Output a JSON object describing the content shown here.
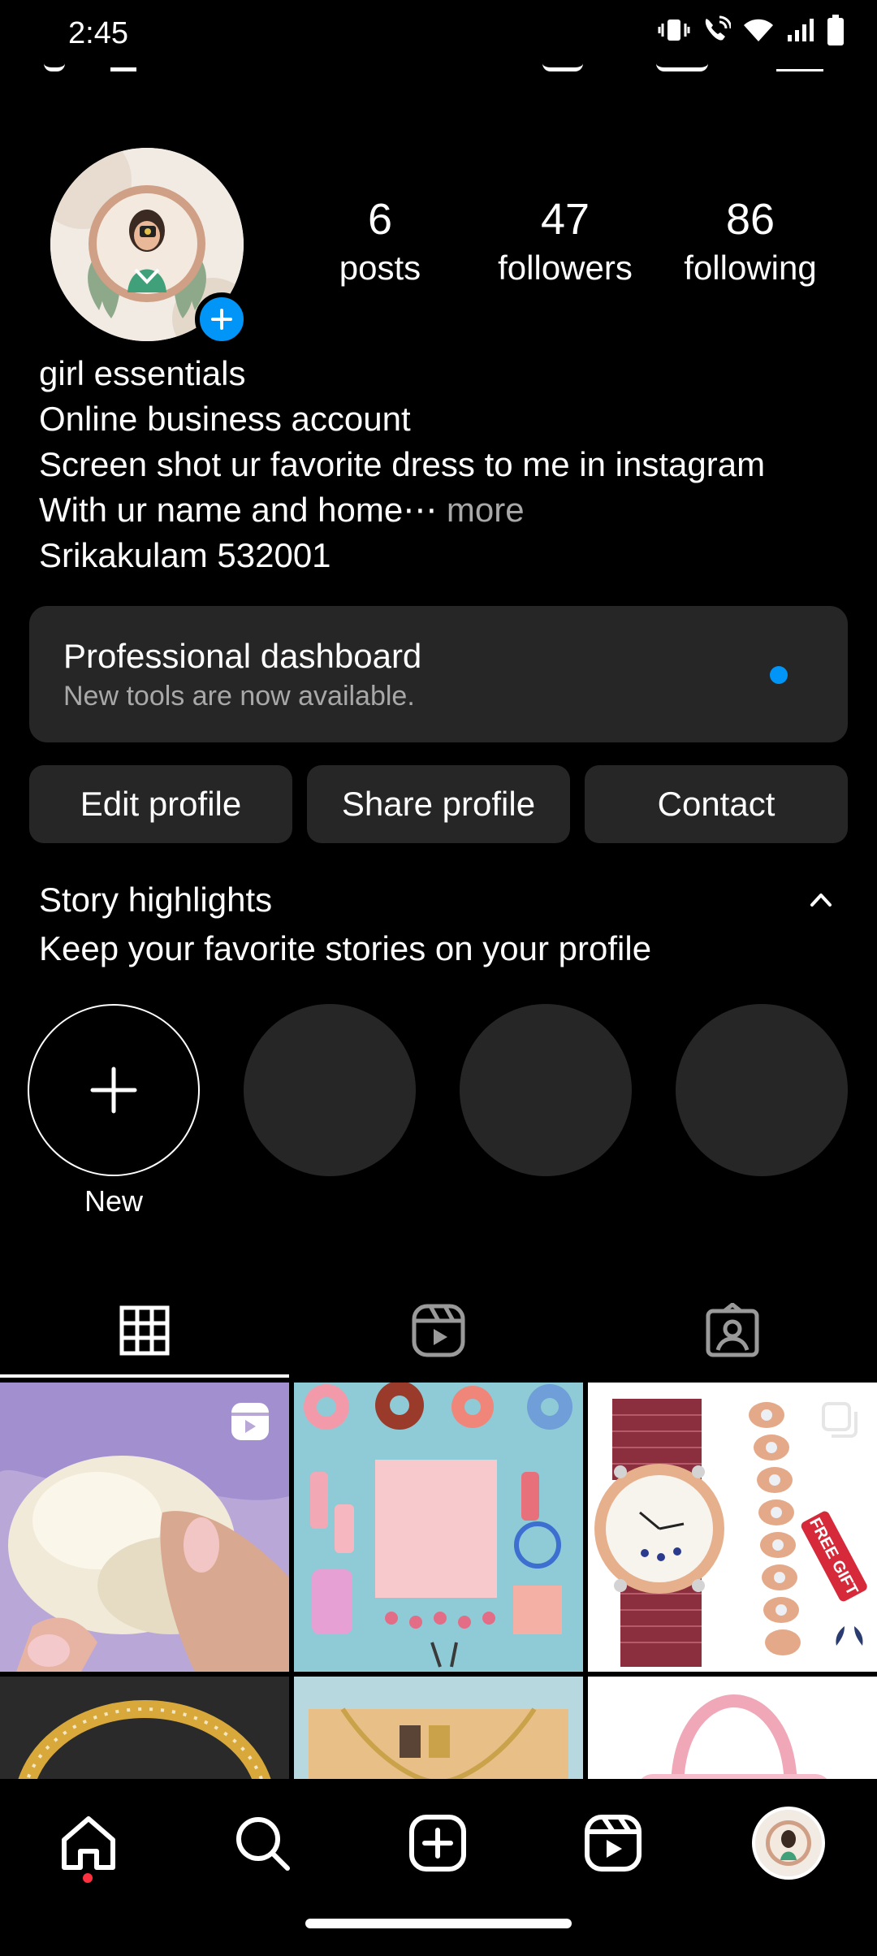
{
  "status_bar": {
    "time": "2:45"
  },
  "profile": {
    "stats": [
      {
        "count": "6",
        "label": "posts"
      },
      {
        "count": "47",
        "label": "followers"
      },
      {
        "count": "86",
        "label": "following"
      }
    ],
    "bio_lines": [
      "girl essentials",
      "Online business account",
      "Screen shot ur favorite dress to me in instagram",
      "With ur name and home⋯",
      "Srikakulam 532001"
    ],
    "more_label": "more"
  },
  "dashboard": {
    "title": "Professional dashboard",
    "subtitle": "New tools are now available."
  },
  "buttons": {
    "edit": "Edit profile",
    "share": "Share profile",
    "contact": "Contact"
  },
  "story_highlights": {
    "title": "Story highlights",
    "subtitle": "Keep your favorite stories on your profile",
    "new_label": "New"
  },
  "grid_text": {
    "free_gift": "FREE GIFT"
  },
  "colors": {
    "accent": "#0095f6",
    "surface": "#262626",
    "muted": "#a8a8a8"
  }
}
